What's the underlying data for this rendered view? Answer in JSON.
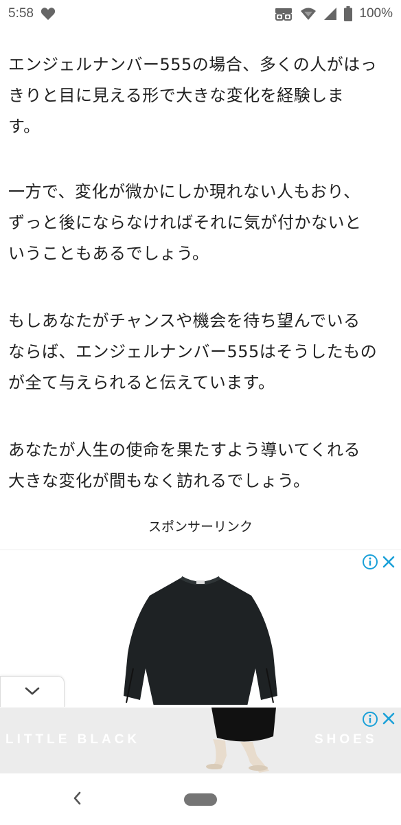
{
  "status_bar": {
    "time": "5:58",
    "battery_percent": "100%",
    "icons": [
      "heart-icon",
      "vpn-icon",
      "wifi-icon",
      "signal-icon",
      "battery-icon"
    ]
  },
  "article": {
    "paragraphs": [
      [
        "エンジェルナンバー555の場合、多くの人がはっ",
        "きりと目に見える形で大きな変化を経験しま",
        "す。"
      ],
      [
        "一方で、変化が微かにしか現れない人もおり、",
        "ずっと後にならなければそれに気が付かないと",
        "いうこともあるでしょう。"
      ],
      [
        "もしあなたがチャンスや機会を待ち望んでいる",
        "ならば、エンジェルナンバー555はそうしたもの",
        "が全て与えられると伝えています。"
      ],
      [
        "あなたが人生の使命を果たすよう導いてくれる",
        "大きな変化が間もなく訪れるでしょう。"
      ]
    ]
  },
  "sponsor_label": "スポンサーリンク",
  "ad": {
    "icons": [
      "ad-info-icon",
      "ad-close-icon"
    ]
  },
  "banner": {
    "left_text": "LITTLE BLACK",
    "right_text": "SHOES"
  },
  "nav": {
    "icons": [
      "back-icon",
      "home-pill"
    ]
  },
  "colors": {
    "ad_accent": "#1aa0d8",
    "banner_bg": "#ececec",
    "text": "#222222"
  }
}
